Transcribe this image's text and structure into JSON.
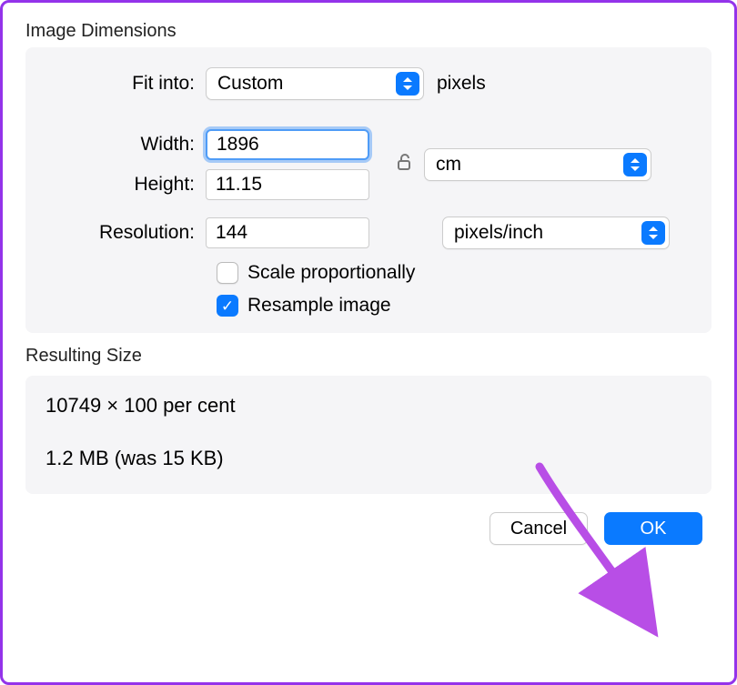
{
  "section_dimensions": "Image Dimensions",
  "fit_into_label": "Fit into:",
  "fit_into_value": "Custom",
  "fit_into_suffix": "pixels",
  "width_label": "Width:",
  "width_value": "1896",
  "height_label": "Height:",
  "height_value": "11.15",
  "unit_dropdown_value": "cm",
  "resolution_label": "Resolution:",
  "resolution_value": "144",
  "resolution_unit_value": "pixels/inch",
  "scale_prop_label": "Scale proportionally",
  "scale_prop_checked": false,
  "resample_label": "Resample image",
  "resample_checked": true,
  "section_resulting": "Resulting Size",
  "result_percent": "10749 × 100 per cent",
  "result_size": "1.2 MB (was 15 KB)",
  "cancel_label": "Cancel",
  "ok_label": "OK",
  "colors": {
    "accent": "#0a7aff",
    "annotation": "#b84ee6"
  }
}
